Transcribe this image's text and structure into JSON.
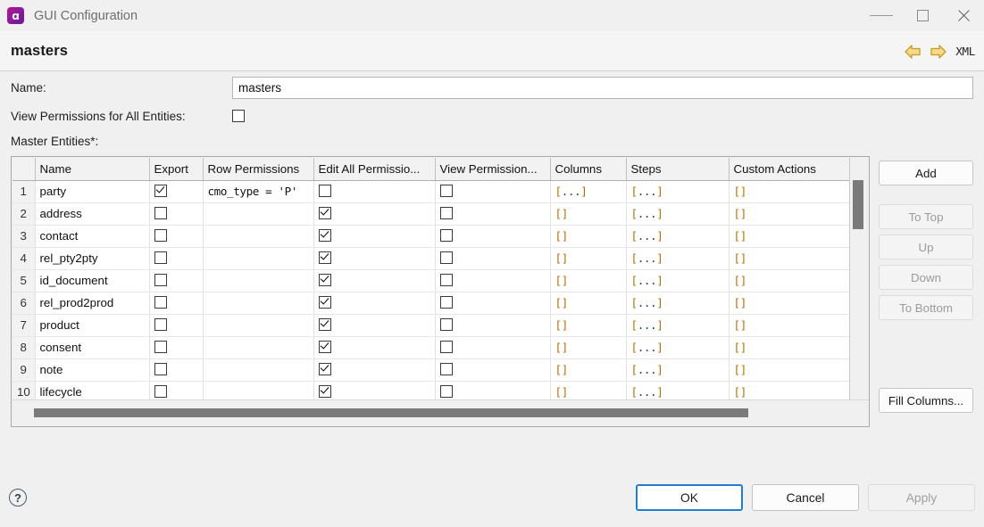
{
  "window": {
    "title": "GUI Configuration",
    "icon": "app-icon",
    "controls": {
      "minimize": "minimize-icon",
      "maximize": "maximize-icon",
      "close": "close-icon"
    }
  },
  "header": {
    "title": "masters",
    "tools": {
      "back": "back-arrow-icon",
      "forward": "forward-arrow-icon",
      "xml": "XML"
    }
  },
  "form": {
    "name_label": "Name:",
    "name_value": "masters",
    "name_placeholder": "",
    "view_permissions_label": "View Permissions for All Entities:",
    "view_permissions_checked": false,
    "master_entities_label": "Master Entities*:"
  },
  "table": {
    "columns": [
      "",
      "Name",
      "Export",
      "Row Permissions",
      "Edit All Permissio...",
      "View Permission...",
      "Columns",
      "Steps",
      "Custom Actions"
    ],
    "rows": [
      {
        "num": "1",
        "name": "party",
        "export": true,
        "row_permissions": "cmo_type = 'P'",
        "edit_all": false,
        "view_permission": false,
        "columns": "[...]",
        "steps": "[...]",
        "custom_actions": "[]"
      },
      {
        "num": "2",
        "name": "address",
        "export": false,
        "row_permissions": "",
        "edit_all": true,
        "view_permission": false,
        "columns": "[]",
        "steps": "[...]",
        "custom_actions": "[]"
      },
      {
        "num": "3",
        "name": "contact",
        "export": false,
        "row_permissions": "",
        "edit_all": true,
        "view_permission": false,
        "columns": "[]",
        "steps": "[...]",
        "custom_actions": "[]"
      },
      {
        "num": "4",
        "name": "rel_pty2pty",
        "export": false,
        "row_permissions": "",
        "edit_all": true,
        "view_permission": false,
        "columns": "[]",
        "steps": "[...]",
        "custom_actions": "[]"
      },
      {
        "num": "5",
        "name": "id_document",
        "export": false,
        "row_permissions": "",
        "edit_all": true,
        "view_permission": false,
        "columns": "[]",
        "steps": "[...]",
        "custom_actions": "[]"
      },
      {
        "num": "6",
        "name": "rel_prod2prod",
        "export": false,
        "row_permissions": "",
        "edit_all": true,
        "view_permission": false,
        "columns": "[]",
        "steps": "[...]",
        "custom_actions": "[]"
      },
      {
        "num": "7",
        "name": "product",
        "export": false,
        "row_permissions": "",
        "edit_all": true,
        "view_permission": false,
        "columns": "[]",
        "steps": "[...]",
        "custom_actions": "[]"
      },
      {
        "num": "8",
        "name": "consent",
        "export": false,
        "row_permissions": "",
        "edit_all": true,
        "view_permission": false,
        "columns": "[]",
        "steps": "[...]",
        "custom_actions": "[]"
      },
      {
        "num": "9",
        "name": "note",
        "export": false,
        "row_permissions": "",
        "edit_all": true,
        "view_permission": false,
        "columns": "[]",
        "steps": "[...]",
        "custom_actions": "[]"
      },
      {
        "num": "10",
        "name": "lifecycle",
        "export": false,
        "row_permissions": "",
        "edit_all": true,
        "view_permission": false,
        "columns": "[]",
        "steps": "[...]",
        "custom_actions": "[]"
      }
    ]
  },
  "side_buttons": [
    {
      "label": "Add",
      "enabled": true
    },
    {
      "label": "To Top",
      "enabled": false
    },
    {
      "label": "Up",
      "enabled": false
    },
    {
      "label": "Down",
      "enabled": false
    },
    {
      "label": "To Bottom",
      "enabled": false
    },
    {
      "label": "Fill Columns...",
      "enabled": true
    }
  ],
  "footer": {
    "help": "?",
    "ok": "OK",
    "cancel": "Cancel",
    "apply": "Apply",
    "apply_enabled": false
  },
  "colors": {
    "accent": "#1f7fd4",
    "bracket": "#b07000",
    "code_text": "#133b8f",
    "window_bg": "#f0f0f0",
    "icon_gradient_start": "#b4148c",
    "icon_gradient_end": "#6a1b9a",
    "arrow_yellow": "#e8b33a"
  }
}
